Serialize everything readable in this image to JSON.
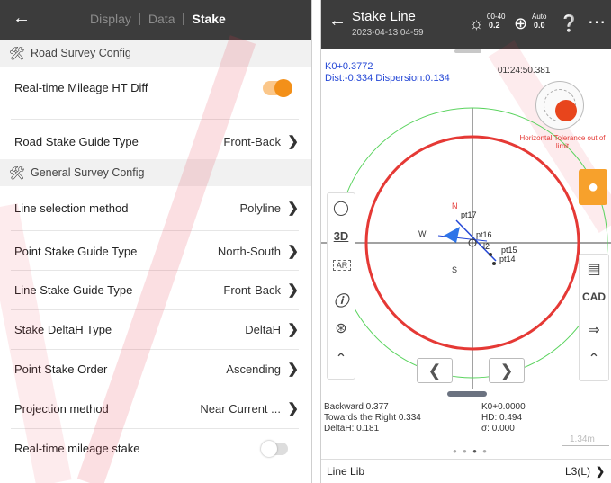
{
  "left_panel": {
    "tabs": [
      "Display",
      "Data",
      "Stake"
    ],
    "active_tab": "Stake",
    "sections": [
      {
        "title": "Road Survey Config",
        "rows": [
          {
            "label": "Real-time Mileage HT Diff",
            "toggle": true
          },
          {
            "label": "Road Stake Guide Type",
            "value": "Front-Back"
          }
        ]
      },
      {
        "title": "General Survey Config",
        "rows": [
          {
            "label": "Line selection method",
            "value": "Polyline"
          },
          {
            "label": "Point Stake Guide Type",
            "value": "North-South"
          },
          {
            "label": "Line Stake Guide Type",
            "value": "Front-Back"
          },
          {
            "label": "Stake DeltaH Type",
            "value": "DeltaH"
          },
          {
            "label": "Point Stake Order",
            "value": "Ascending"
          },
          {
            "label": "Projection method",
            "value": "Near Current ..."
          },
          {
            "label": "Real-time mileage stake",
            "toggle": false
          }
        ]
      }
    ],
    "colors": {
      "toggle_on": "#f39019",
      "header_bg": "#3c3c3c"
    }
  },
  "right_panel": {
    "title": "Stake Line",
    "datetime": "2023-04-13 04-59",
    "status": {
      "satellite": {
        "top": "00-40",
        "bottom": "0.2"
      },
      "position": {
        "top": "Auto",
        "bottom": "0.0"
      },
      "tower": {
        "top": "",
        "bottom": ""
      }
    },
    "station": "K0+0.3772",
    "dist_line": "Dist:-0.334 Dispersion:0.134",
    "time": "01:24:50.381",
    "warning": "Horizontal Tolerance out of limit",
    "map_labels": {
      "north": "N",
      "south": "S",
      "west": "W",
      "points": [
        "pt17",
        "pt16",
        "pt15",
        "pt14",
        "l2"
      ]
    },
    "tools_left": [
      "target-icon",
      "3D",
      "AR",
      "info-icon",
      "collapse-icon",
      "up-chevron-icon"
    ],
    "tools_right": [
      "profile-icon",
      "CAD",
      "arrow-icon",
      "up-chevron-icon"
    ],
    "bottom": {
      "left_lines": [
        "Backward 0.377",
        "Towards the Right 0.334",
        "DeltaH: 0.181"
      ],
      "right_lines": [
        "K0+0.0000",
        "HD: 0.494",
        "σ: 0.000"
      ],
      "scale": "1.34m"
    },
    "line_lib": {
      "label": "Line Lib",
      "value": "L3(L)"
    },
    "colors": {
      "accent": "#f7a12c",
      "circle_red": "#e53935",
      "circle_green": "#59d35d",
      "blue_text": "#2447d6"
    }
  }
}
